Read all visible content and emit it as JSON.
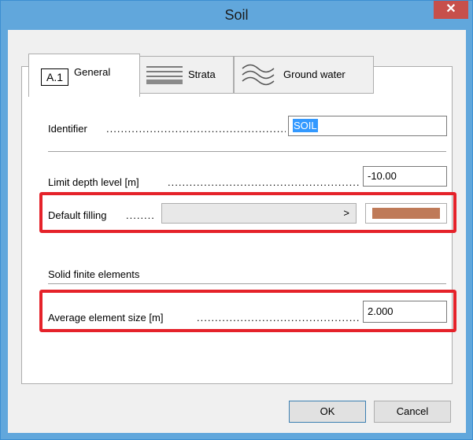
{
  "window": {
    "title": "Soil"
  },
  "tabs": [
    {
      "label": "General",
      "badge": "A.1"
    },
    {
      "label": "Strata"
    },
    {
      "label": "Ground water"
    }
  ],
  "fields": {
    "identifier": {
      "label": "Identifier",
      "value": "SOIL"
    },
    "limit_depth": {
      "label": "Limit depth level [m]",
      "value": "-10.00"
    },
    "default_filling": {
      "label": "Default filling",
      "combo_arrow": ">",
      "color": "#bf7a58"
    },
    "section_title": "Solid finite elements",
    "avg_element_size": {
      "label": "Average element size [m]",
      "value": "2.000"
    }
  },
  "buttons": {
    "ok": "OK",
    "cancel": "Cancel"
  },
  "icons": {
    "close": "close-icon",
    "strata": "strata-lines-icon",
    "water": "wave-icon"
  },
  "colors": {
    "highlight": "#e5222a",
    "titlebar": "#61a7dc",
    "close": "#c7504b"
  }
}
